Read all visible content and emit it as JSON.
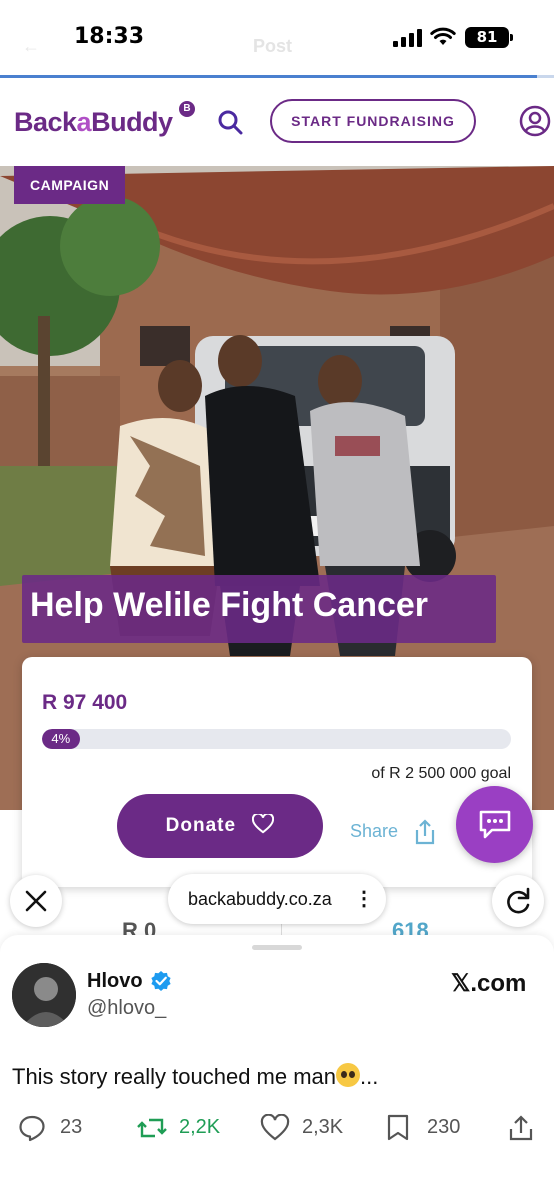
{
  "status_bar": {
    "time": "18:33",
    "battery": "81",
    "ghost_title": "Post"
  },
  "page_load_progress": 0.97,
  "site": {
    "logo_main": "Back",
    "logo_a": "a",
    "logo_end": "Buddy",
    "logo_badge": "B",
    "start_label": "START FUNDRAISING"
  },
  "campaign": {
    "tag": "CAMPAIGN",
    "title": "Help Welile Fight Cancer",
    "amount": "R 97 400",
    "progress_label": "4%",
    "progress_fraction": 0.04,
    "goal": "of R 2 500 000 goal",
    "donate_label": "Donate",
    "share_label": "Share"
  },
  "stats_peek": {
    "left": "R 0",
    "right": "618"
  },
  "browser": {
    "url": "backabuddy.co.za",
    "more": "⋮"
  },
  "tweet": {
    "name": "Hlovo",
    "handle": "@hlovo_",
    "source": "𝕏.com",
    "text": "This story really touched me man",
    "ellipsis": "...",
    "replies": "23",
    "reposts": "2,2K",
    "likes": "2,3K",
    "bookmarks": "230"
  },
  "colors": {
    "brand_purple": "#6b2a86",
    "fab_purple": "#9a3fc3",
    "share_blue": "#6cb3d4",
    "repost_green": "#1f9d55",
    "verified_blue": "#1d9bf0"
  }
}
